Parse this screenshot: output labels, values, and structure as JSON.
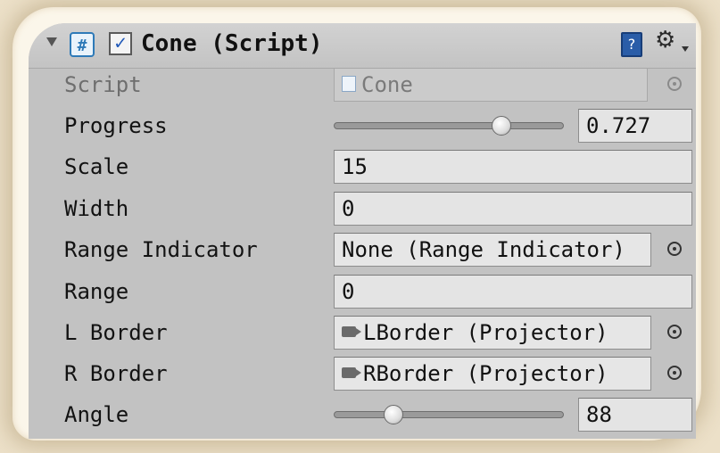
{
  "header": {
    "title": "Cone (Script)",
    "enabled": true
  },
  "fields": {
    "script": {
      "label": "Script",
      "value": "Cone"
    },
    "progress": {
      "label": "Progress",
      "value": "0.727",
      "slider_fraction": 0.727
    },
    "scale": {
      "label": "Scale",
      "value": "15"
    },
    "width": {
      "label": "Width",
      "value": "0"
    },
    "range_indicator": {
      "label": "Range Indicator",
      "value": "None (Range Indicator)"
    },
    "range": {
      "label": "Range",
      "value": "0"
    },
    "l_border": {
      "label": "L Border",
      "value": "LBorder (Projector)"
    },
    "r_border": {
      "label": "R Border",
      "value": "RBorder (Projector)"
    },
    "angle": {
      "label": "Angle",
      "value": "88",
      "slider_fraction": 0.26
    }
  },
  "icons": {
    "foldout": "chevron-down-icon",
    "script": "csharp-script-icon",
    "help": "help-book-icon",
    "settings": "gear-icon",
    "object_picker": "object-picker-icon",
    "projector": "projector-icon"
  },
  "colors": {
    "panel": "#c2c2c2",
    "field": "#e4e4e4",
    "checkbox_tick": "#1f58b8",
    "script_icon": "#2e7ab8",
    "help_icon": "#2a5da8"
  }
}
